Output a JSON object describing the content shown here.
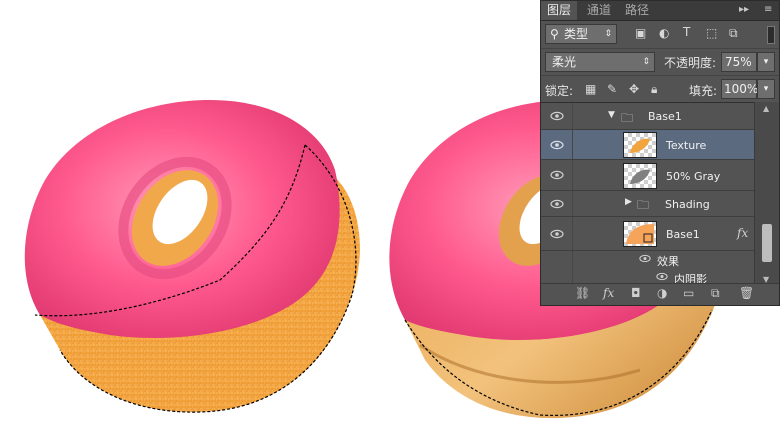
{
  "canvas": {
    "background": "#ffffff",
    "icing_color": "#ff4f88",
    "dough_color": "#f5a640",
    "marching_ants": true
  },
  "panel": {
    "tabs": [
      "图层",
      "通道",
      "路径"
    ],
    "active_tab": "图层",
    "menu_glyphs": {
      "collapse": "▸▸",
      "menu": "≡"
    },
    "filter": {
      "icon": "search-icon",
      "label": "类型"
    },
    "blend_mode": "柔光",
    "opacity_label": "不透明度:",
    "opacity_value": "75%",
    "lock_label": "锁定:",
    "fill_label": "填充:",
    "fill_value": "100%",
    "layers": [
      {
        "name": "Base1",
        "type": "group",
        "expanded": true,
        "visible": true
      },
      {
        "name": "Texture",
        "type": "layer",
        "selected": true,
        "visible": true
      },
      {
        "name": "50% Gray",
        "type": "layer",
        "visible": true
      },
      {
        "name": "Shading",
        "type": "group",
        "expanded": false,
        "visible": true
      },
      {
        "name": "Base1",
        "type": "layer",
        "fx": "fx",
        "visible": true
      },
      {
        "name": "效果",
        "type": "effects-header",
        "visible": true
      },
      {
        "name": "内阴影",
        "type": "effect",
        "visible": true
      }
    ],
    "bottom_icons": [
      "link-icon",
      "fx-icon",
      "mask-icon",
      "adjustment-icon",
      "folder-icon",
      "new-layer-icon",
      "trash-icon"
    ]
  }
}
